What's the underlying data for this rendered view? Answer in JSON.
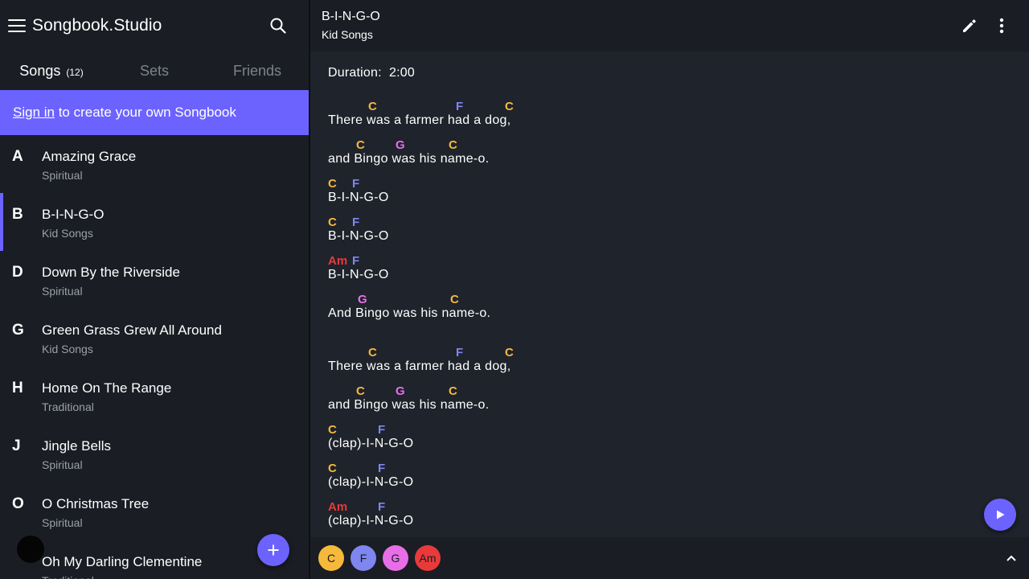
{
  "app": {
    "title": "Songbook.Studio"
  },
  "sidebar": {
    "tabs": [
      {
        "label": "Songs",
        "count": "(12)"
      },
      {
        "label": "Sets"
      },
      {
        "label": "Friends"
      }
    ],
    "signin": {
      "link": "Sign in",
      "text": " to create your own Songbook"
    },
    "songs": [
      {
        "letter": "A",
        "title": "Amazing Grace",
        "artist": "Spiritual"
      },
      {
        "letter": "B",
        "title": "B-I-N-G-O",
        "artist": "Kid Songs"
      },
      {
        "letter": "D",
        "title": "Down By the Riverside",
        "artist": "Spiritual"
      },
      {
        "letter": "G",
        "title": "Green Grass Grew All Around",
        "artist": "Kid Songs"
      },
      {
        "letter": "H",
        "title": "Home On The Range",
        "artist": "Traditional"
      },
      {
        "letter": "J",
        "title": "Jingle Bells",
        "artist": "Spiritual"
      },
      {
        "letter": "O",
        "title": "O Christmas Tree",
        "artist": "Spiritual"
      },
      {
        "letter": "",
        "title": "Oh My Darling Clementine",
        "artist": "Traditional"
      }
    ]
  },
  "main": {
    "title": "B-I-N-G-O",
    "subtitle": "Kid Songs",
    "duration_label": "Duration:",
    "duration_value": "2:00",
    "lines": [
      "There was a farmer had a dog,",
      "and Bingo was his name-o.",
      "B-I-N-G-O",
      "B-I-N-G-O",
      "B-I-N-G-O",
      "And Bingo was his name-o.",
      "There was a farmer had a dog,",
      "and Bingo was his name-o.",
      "(clap)-I-N-G-O",
      "(clap)-I-N-G-O",
      "(clap)-I-N-G-O"
    ]
  },
  "chords": {
    "C": {
      "label": "C",
      "color": "#f6b93b"
    },
    "F": {
      "label": "F",
      "color": "#7f86f0"
    },
    "G": {
      "label": "G",
      "color": "#e86ee8"
    },
    "Am": {
      "label": "Am",
      "color": "#e83a3a"
    }
  },
  "bottombar": {
    "chips": [
      "C",
      "F",
      "G",
      "Am"
    ]
  },
  "colors": {
    "accent": "#6c63ff",
    "background": "#1f232b",
    "sidebar": "#1a1d23"
  }
}
